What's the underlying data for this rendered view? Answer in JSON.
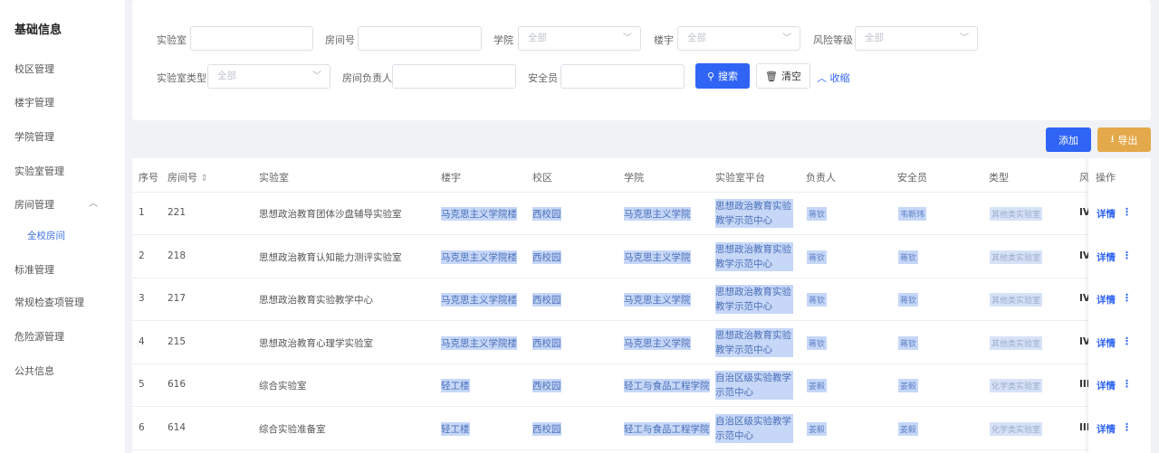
{
  "sidebar": {
    "title": "基础信息",
    "items": [
      "校区管理",
      "楼宇管理",
      "学院管理",
      "实验室管理",
      "房间管理",
      "标准管理",
      "常规检查项管理",
      "危险源管理",
      "公共信息"
    ],
    "sub_item": "全校房间"
  },
  "filters": {
    "lab_label": "实验室",
    "room_label": "房间号",
    "college_label": "学院",
    "college_value": "全部",
    "building_label": "楼宇",
    "building_value": "全部",
    "risk_label": "风险等级",
    "risk_value": "全部",
    "labtype_label": "实验室类型",
    "labtype_value": "全部",
    "owner_label": "房间负责人",
    "safety_label": "安全员",
    "search_label": "搜索",
    "clear_label": "清空",
    "collapse_label": "收缩"
  },
  "actions": {
    "add_label": "添加",
    "export_label": "导出"
  },
  "table": {
    "headers": [
      "序号",
      "房间号",
      "实验室",
      "楼宇",
      "校区",
      "学院",
      "实验室平台",
      "负责人",
      "安全员",
      "类型",
      "风",
      "操作"
    ],
    "rows": [
      {
        "no": "1",
        "room": "221",
        "lab": "思想政治教育团体沙盘辅导实验室",
        "building": "马克思主义学院楼",
        "campus": "西校园",
        "college": "马克思主义学院",
        "platform": "思想政治教育实验教学示范中心",
        "owner": "蒋钦",
        "safety": "韦新玮",
        "type": "其他类实验室",
        "risk": "IV"
      },
      {
        "no": "2",
        "room": "218",
        "lab": "思想政治教育认知能力测评实验室",
        "building": "马克思主义学院楼",
        "campus": "西校园",
        "college": "马克思主义学院",
        "platform": "思想政治教育实验教学示范中心",
        "owner": "蒋钦",
        "safety": "蒋钦",
        "type": "其他类实验室",
        "risk": "IV"
      },
      {
        "no": "3",
        "room": "217",
        "lab": "思想政治教育实验教学中心",
        "building": "马克思主义学院楼",
        "campus": "西校园",
        "college": "马克思主义学院",
        "platform": "思想政治教育实验教学示范中心",
        "owner": "蒋钦",
        "safety": "蒋钦",
        "type": "其他类实验室",
        "risk": "IV"
      },
      {
        "no": "4",
        "room": "215",
        "lab": "思想政治教育心理学实验室",
        "building": "马克思主义学院楼",
        "campus": "西校园",
        "college": "马克思主义学院",
        "platform": "思想政治教育实验教学示范中心",
        "owner": "蒋钦",
        "safety": "蒋钦",
        "type": "其他类实验室",
        "risk": "IV"
      },
      {
        "no": "5",
        "room": "616",
        "lab": "综合实验室",
        "building": "轻工楼",
        "campus": "西校园",
        "college": "轻工与食品工程学院",
        "platform": "自治区级实验教学示范中心",
        "owner": "姜毅",
        "safety": "姜毅",
        "type": "化学类实验室",
        "risk": "III"
      },
      {
        "no": "6",
        "room": "614",
        "lab": "综合实验准备室",
        "building": "轻工楼",
        "campus": "西校园",
        "college": "轻工与食品工程学院",
        "platform": "自治区级实验教学示范中心",
        "owner": "姜毅",
        "safety": "姜毅",
        "type": "化学类实验室",
        "risk": "III"
      }
    ],
    "detail_label": "详情",
    "more_label": "⋮",
    "sort_icon": "⇕"
  },
  "icons": {
    "search": "search-icon",
    "trash": "trash-icon",
    "download": "download-icon",
    "chevron": "chevron-down-icon"
  },
  "colors": {
    "primary": "#2f64f5",
    "export": "#e4a94a",
    "highlight": "#c6d7f7"
  }
}
